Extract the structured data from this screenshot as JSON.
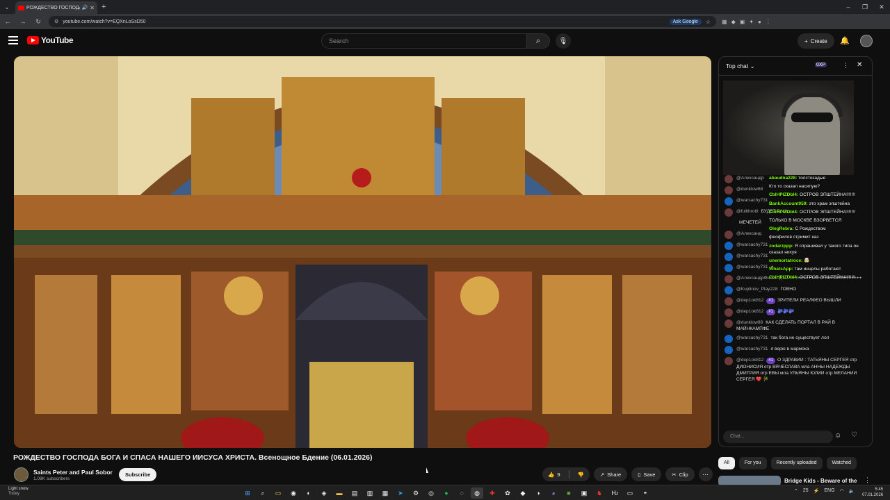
{
  "browser": {
    "tab_title": "РОЖДЕСТВО ГОСПОДА Б...",
    "url": "youtube.com/watch?v=EQXnLoSsD50",
    "ask_google": "Ask Google",
    "new_tab": "+",
    "win_min": "–",
    "win_max": "❐",
    "win_close": "✕"
  },
  "youtube": {
    "logo_text": "YouTube",
    "search_placeholder": "Search",
    "create_label": "Create"
  },
  "video": {
    "title": "РОЖДЕСТВО ГОСПОДА БОГА И СПАСА НАШЕГО ИИСУСА ХРИСТА. Всенощное Бдение (06.01.2026)",
    "channel_name": "Saints Peter and Paul Sobor",
    "subscribers": "1.08K subscribers",
    "subscribe_label": "Subscribe",
    "likes": "9",
    "share_label": "Share",
    "save_label": "Save",
    "clip_label": "Clip"
  },
  "chat": {
    "header": "Top chat ⌄",
    "xp": "0XP",
    "input_placeholder": "Chat...",
    "messages": [
      {
        "author": "@Александр",
        "text": ""
      },
      {
        "author": "@dunklow88",
        "text": ""
      },
      {
        "author": "@warsachy731",
        "text": ""
      },
      {
        "author": "@fullthrottl",
        "text": "БУДЕТ В ЧА..."
      },
      {
        "author": "",
        "text": "МЕЧЕТЕЙ"
      },
      {
        "author": "@Александ",
        "text": ""
      },
      {
        "author": "@warsachy731",
        "text": ""
      },
      {
        "author": "@warsachy731",
        "text": ""
      },
      {
        "author": "@warsachy731",
        "text": "+"
      },
      {
        "author": "@АлександрФилин-д1с",
        "text": "+++++++++++++++++++++++++++"
      },
      {
        "author": "@Kuplinov_Play228",
        "text": "ГОВНО"
      },
      {
        "author": "@dep1ok812",
        "badge": "#1",
        "text": "ЗРИТЕЛИ РЕАЛФЕО ВЫШЛИ"
      },
      {
        "author": "@dep1ok812",
        "badge": "#1",
        "text": "🫐🫐🫐"
      },
      {
        "author": "@dunklow88",
        "text": "КАК СДЕЛАТЬ ПОРТАЛ В РАЙ В МАЙНКАМПФЕ"
      },
      {
        "author": "@warsachy731",
        "text": "так бога не существует лол"
      },
      {
        "author": "@warsachy731",
        "text": "я верю в мармока"
      },
      {
        "author": "@dep1ok812",
        "badge": "#1",
        "text": "О ЗДРАВИИ : ТАТЬЯНЫ СЕРГЕЯ отр ДИОНИСИЯ отр ВЯЧЕСЛАВА мла АННЫ НАДЕЖДЫ ДМИТРИЯ отр ЕВЫ мла УЛЬЯНЫ ЮЛИИ отр МЕЛАНИИ СЕРГЕЯ ❤️ 🎋"
      }
    ],
    "overlay": [
      {
        "user": "abaudna228:",
        "text": "толстозадые"
      },
      {
        "user": "",
        "text": "Кто то сказал насилую?"
      },
      {
        "user": "CbIHPIZDbI4:",
        "text": "ОСТРОВ ЭПШТЕЙНА!!!!!!!"
      },
      {
        "user": "BankAccount059:",
        "text": "это храм эпштейна"
      },
      {
        "user": "CbIHPIZDbI4:",
        "text": "ОСТРОВ ЭПШТЕЙНА!!!!!!!"
      },
      {
        "user": "",
        "text": "ТОЛЬКО В МОСКВЕ ВЗОРВЕТСЯ"
      },
      {
        "user": "OlegRebra:",
        "text": "С Рождеством"
      },
      {
        "user": "",
        "text": "феофилов стримит каз"
      },
      {
        "user": "zodarzppp:",
        "text": "Я спрашивал у такого типа он сказал нихуя"
      },
      {
        "user": "unemortatroce:",
        "text": "🤯"
      },
      {
        "user": "WhatsApp:",
        "text": "там инцелы работают"
      },
      {
        "user": "CbIHPIZDbI4:",
        "text": "ОСТРОВ ЭПШТЕЙНА!!!!!!!"
      }
    ]
  },
  "filters": [
    "All",
    "For you",
    "Recently uploaded",
    "Watched"
  ],
  "recommendation": {
    "title": "Bridge Kids - Beware of the"
  },
  "taskbar": {
    "weather": "Light snow",
    "weather_sub": "Today",
    "lang": "ENG",
    "volume": "25",
    "time": "5:45",
    "date": "07.01.2026"
  }
}
